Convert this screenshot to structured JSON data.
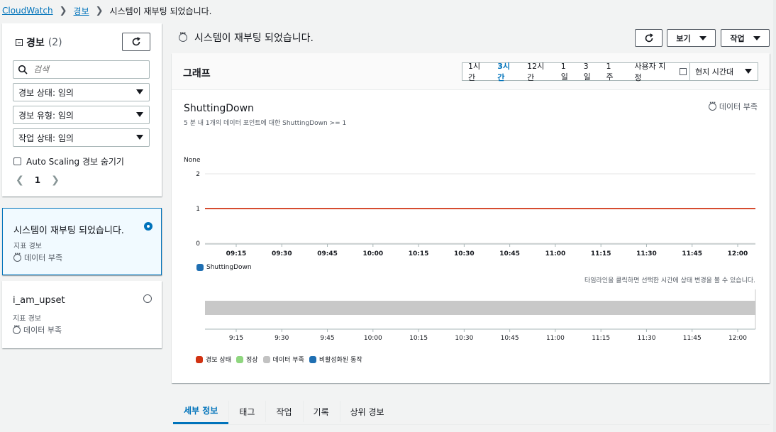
{
  "breadcrumb": {
    "root": "CloudWatch",
    "section": "경보",
    "current": "시스템이 재부팅 되었습니다."
  },
  "sidebar": {
    "title": "경보",
    "count": "(2)",
    "search_placeholder": "검색",
    "filters": [
      "경보 상태: 임의",
      "경보 유형: 임의",
      "작업 상태: 임의"
    ],
    "hide_autoscaling_label": "Auto Scaling 경보 숨기기",
    "page": "1",
    "alarms": [
      {
        "name": "시스템이 재부팅 되었습니다.",
        "type": "지표 경보",
        "state": "데이터 부족",
        "selected": true
      },
      {
        "name": "i_am_upset",
        "type": "지표 경보",
        "state": "데이터 부족",
        "selected": false
      }
    ]
  },
  "main": {
    "title": "시스템이 재부팅 되었습니다.",
    "view_label": "보기",
    "actions_label": "작업"
  },
  "graph": {
    "header": "그래프",
    "ranges": [
      "1시간",
      "3시간",
      "12시간",
      "1일",
      "3일",
      "1주"
    ],
    "active_range": "3시간",
    "custom_label": "사용자 지정",
    "timezone": "현지 시간대",
    "metric_title": "ShuttingDown",
    "metric_subtitle": "5 분 내 1개의 데이터 포인트에 대한 ShuttingDown >= 1",
    "state": "데이터 부족",
    "unit_label": "None",
    "timeline_hint": "타임라인을 클릭하면 선택한 시간에 상태 변경을 볼 수 있습니다.",
    "series_legend": "ShuttingDown",
    "status_legend": [
      {
        "label": "경보 상태",
        "color": "#d13212"
      },
      {
        "label": "정상",
        "color": "#8fd67f"
      },
      {
        "label": "데이터 부족",
        "color": "#c2c2c2"
      },
      {
        "label": "비활성화된 동작",
        "color": "#1f6fb2"
      }
    ]
  },
  "chart_data": {
    "type": "line",
    "ylabel": "None",
    "ylim": [
      0,
      2
    ],
    "yticks": [
      "2",
      "1",
      "0"
    ],
    "x_ticks": [
      "09:15",
      "09:30",
      "09:45",
      "10:00",
      "10:15",
      "10:30",
      "10:45",
      "11:00",
      "11:15",
      "11:30",
      "11:45",
      "12:00"
    ],
    "timeline_ticks": [
      "9:15",
      "9:30",
      "9:45",
      "10:00",
      "10:15",
      "10:30",
      "10:45",
      "11:00",
      "11:15",
      "11:30",
      "11:45",
      "12:00"
    ],
    "threshold": 1,
    "threshold_color": "#d13212",
    "series": [
      {
        "name": "ShuttingDown",
        "values": [],
        "color": "#1f6fb2"
      }
    ],
    "timeline_state": "데이터 부족"
  },
  "tabs": [
    "세부 정보",
    "태그",
    "작업",
    "기록",
    "상위 경보"
  ],
  "active_tab": "세부 정보"
}
